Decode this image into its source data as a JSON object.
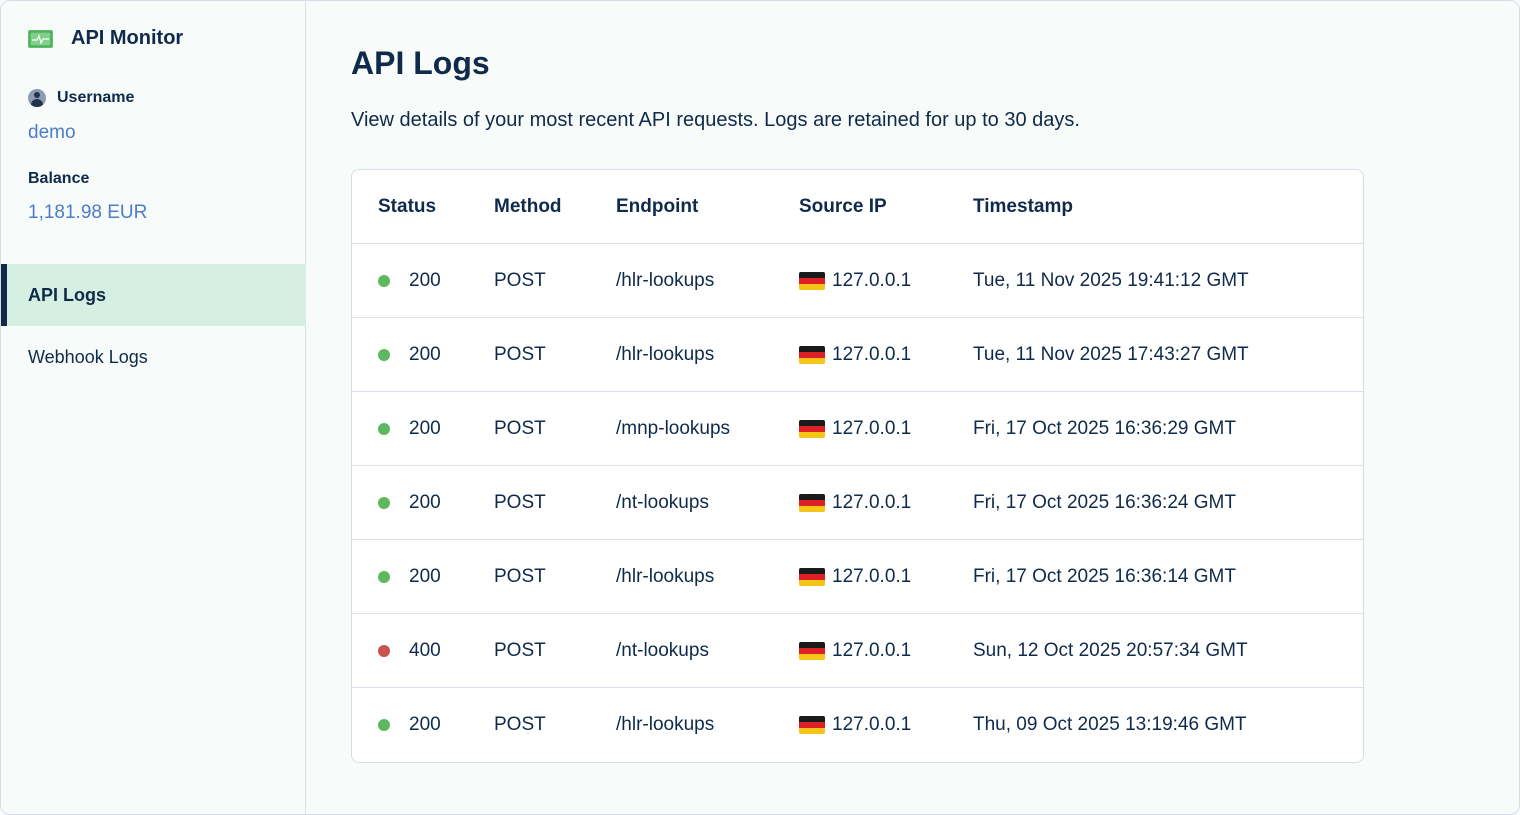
{
  "sidebar": {
    "brand": {
      "title": "API Monitor",
      "icon": "monitor-pulse-icon"
    },
    "username_label": "Username",
    "username_value": "demo",
    "balance_label": "Balance",
    "balance_value": "1,181.98 EUR",
    "nav": [
      {
        "label": "API Logs",
        "active": true
      },
      {
        "label": "Webhook Logs",
        "active": false
      }
    ]
  },
  "main": {
    "title": "API Logs",
    "description": "View details of your most recent API requests. Logs are retained for up to 30 days."
  },
  "table": {
    "headers": {
      "status": "Status",
      "method": "Method",
      "endpoint": "Endpoint",
      "source_ip": "Source IP",
      "timestamp": "Timestamp"
    },
    "rows": [
      {
        "status": "200",
        "status_color": "#5cb85c",
        "method": "POST",
        "endpoint": "/hlr-lookups",
        "flag": "germany-flag-icon",
        "ip": "127.0.0.1",
        "timestamp": "Tue, 11 Nov 2025 19:41:12 GMT"
      },
      {
        "status": "200",
        "status_color": "#5cb85c",
        "method": "POST",
        "endpoint": "/hlr-lookups",
        "flag": "germany-flag-icon",
        "ip": "127.0.0.1",
        "timestamp": "Tue, 11 Nov 2025 17:43:27 GMT"
      },
      {
        "status": "200",
        "status_color": "#5cb85c",
        "method": "POST",
        "endpoint": "/mnp-lookups",
        "flag": "germany-flag-icon",
        "ip": "127.0.0.1",
        "timestamp": "Fri, 17 Oct 2025 16:36:29 GMT"
      },
      {
        "status": "200",
        "status_color": "#5cb85c",
        "method": "POST",
        "endpoint": "/nt-lookups",
        "flag": "germany-flag-icon",
        "ip": "127.0.0.1",
        "timestamp": "Fri, 17 Oct 2025 16:36:24 GMT"
      },
      {
        "status": "200",
        "status_color": "#5cb85c",
        "method": "POST",
        "endpoint": "/hlr-lookups",
        "flag": "germany-flag-icon",
        "ip": "127.0.0.1",
        "timestamp": "Fri, 17 Oct 2025 16:36:14 GMT"
      },
      {
        "status": "400",
        "status_color": "#c9534f",
        "method": "POST",
        "endpoint": "/nt-lookups",
        "flag": "germany-flag-icon",
        "ip": "127.0.0.1",
        "timestamp": "Sun, 12 Oct 2025 20:57:34 GMT"
      },
      {
        "status": "200",
        "status_color": "#5cb85c",
        "method": "POST",
        "endpoint": "/hlr-lookups",
        "flag": "germany-flag-icon",
        "ip": "127.0.0.1",
        "timestamp": "Thu, 09 Oct 2025 13:19:46 GMT"
      }
    ]
  },
  "colors": {
    "accent": "#0f2a4a",
    "link": "#4f7cc8",
    "active_nav_bg": "#d5efe2",
    "ok": "#5cb85c",
    "error": "#c9534f"
  }
}
